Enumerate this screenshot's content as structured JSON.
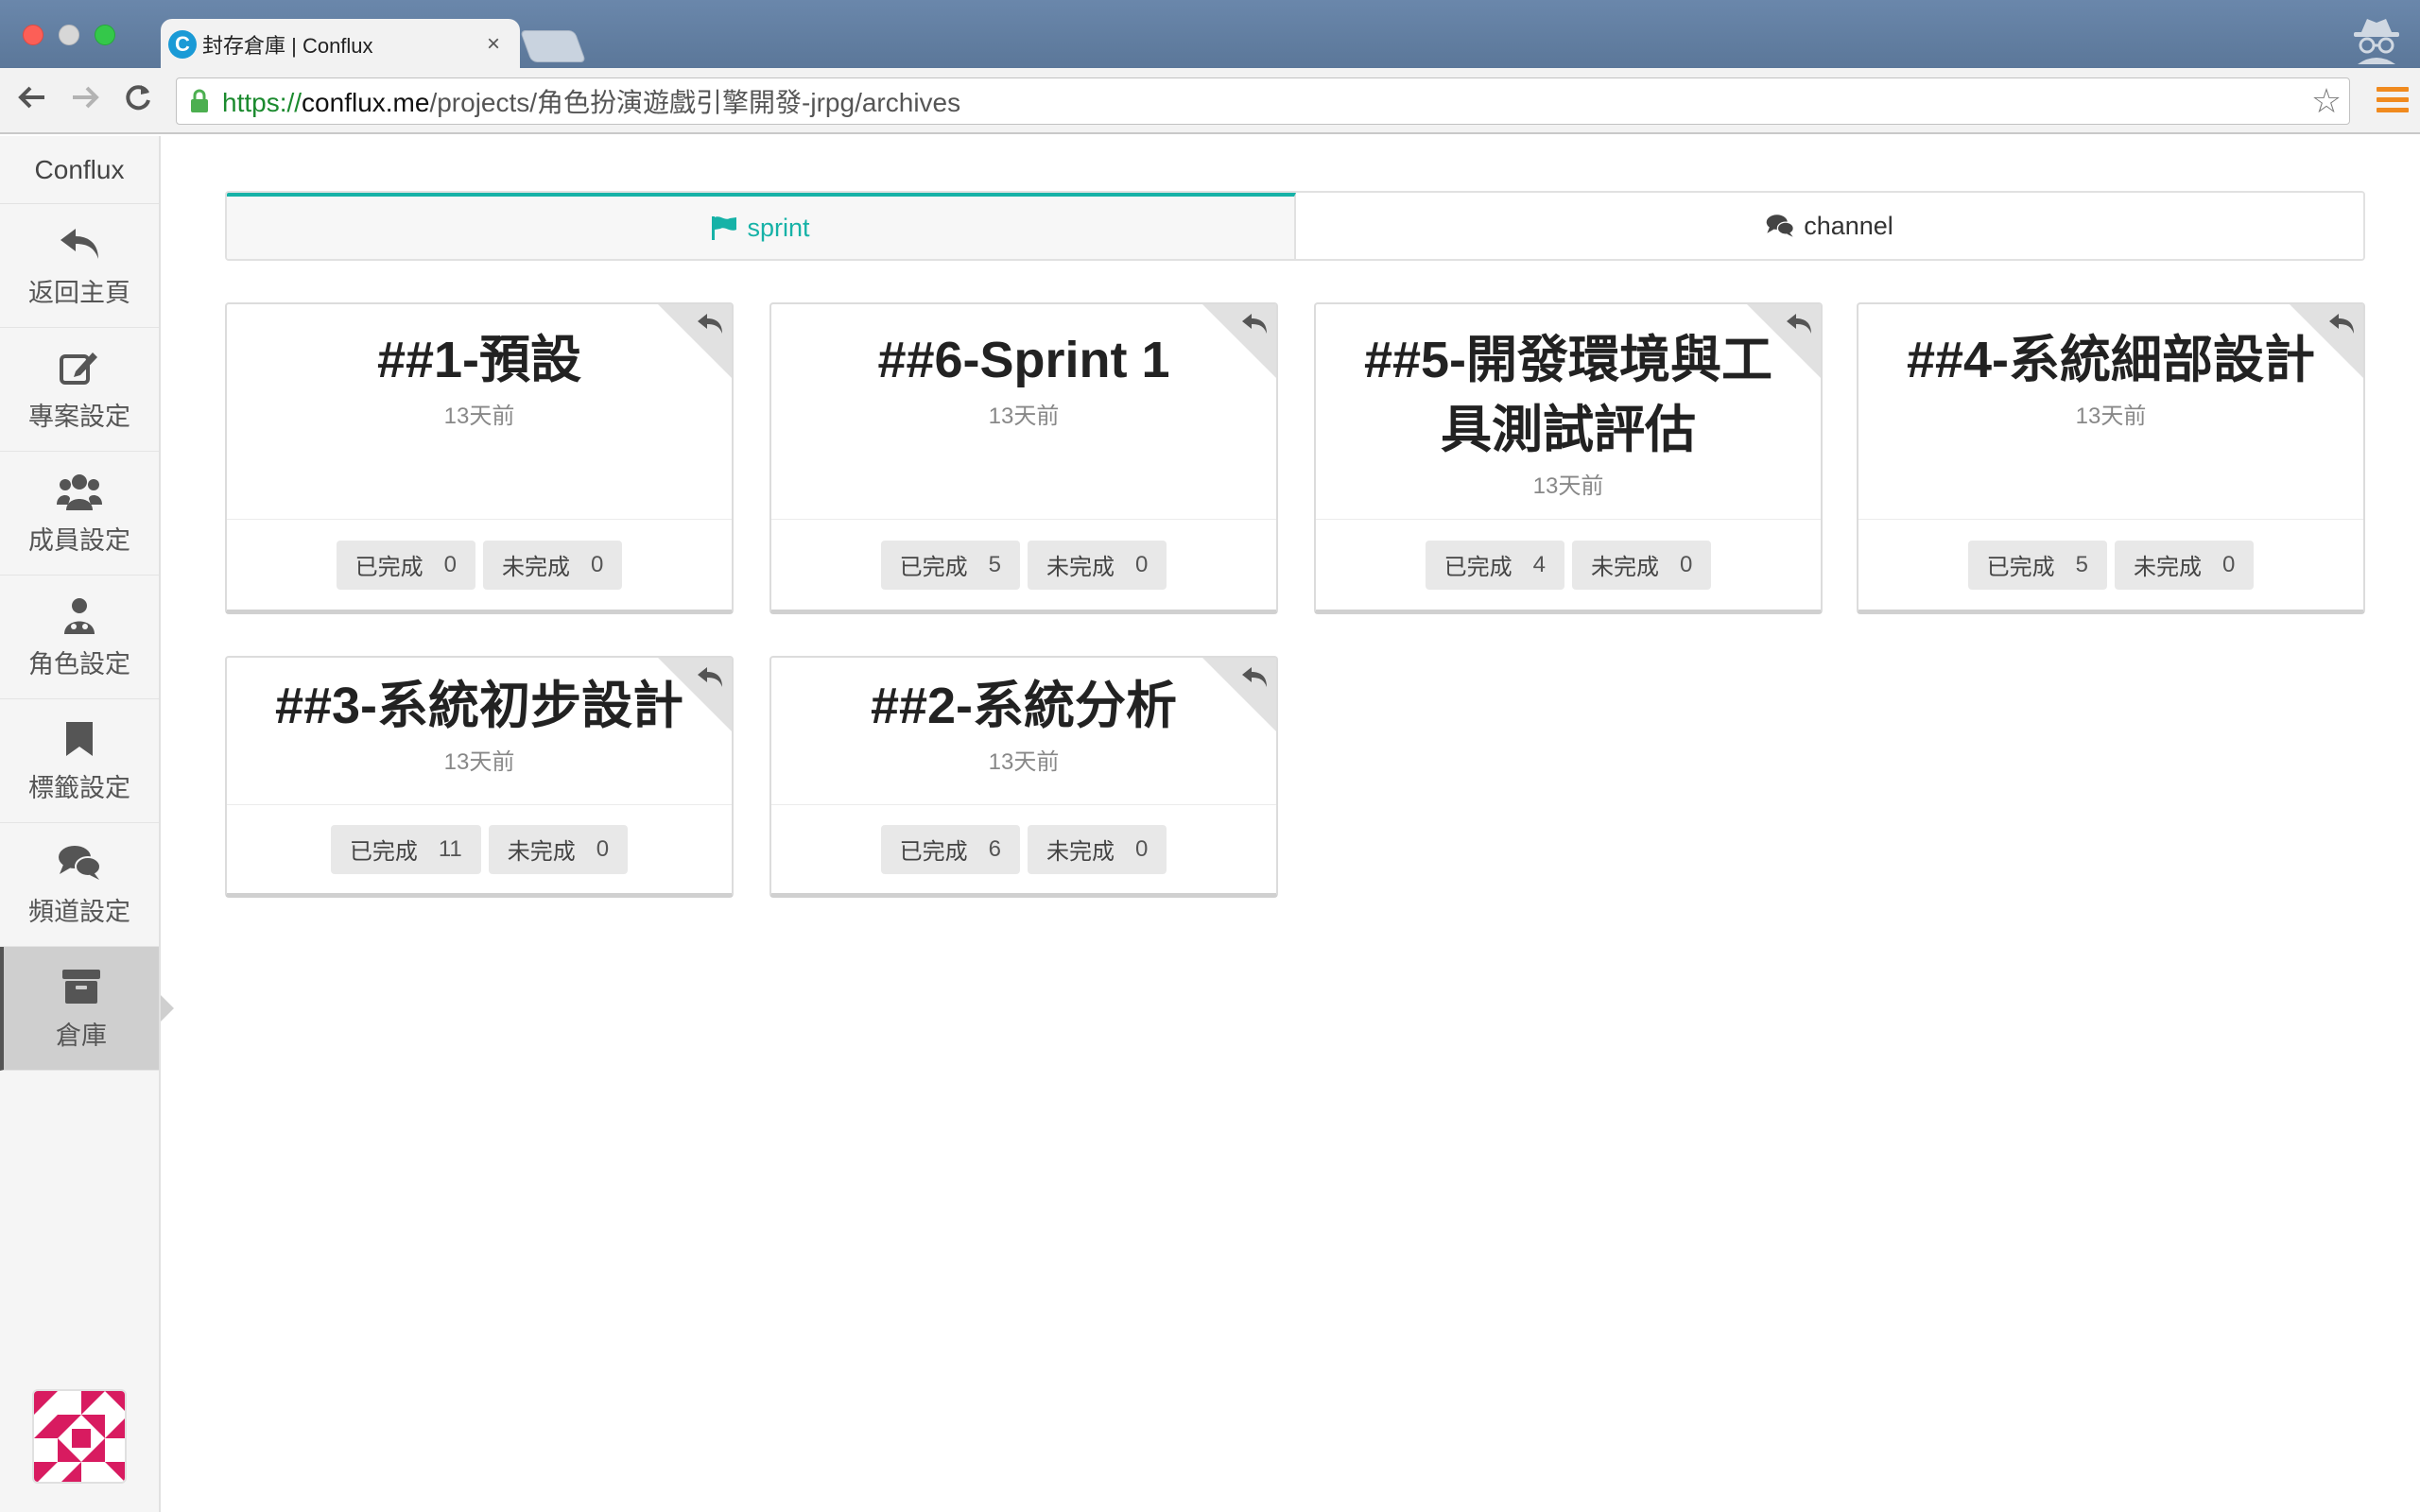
{
  "browser": {
    "tab_title": "封存倉庫 | Conflux",
    "tab_close": "×",
    "url_scheme": "https://",
    "url_host": "conflux.me",
    "url_path": "/projects/角色扮演遊戲引擎開發-jrpg/archives"
  },
  "sidebar": {
    "brand": "Conflux",
    "items": [
      {
        "label": "返回主頁",
        "icon": "reply-arrow-icon"
      },
      {
        "label": "專案設定",
        "icon": "edit-icon"
      },
      {
        "label": "成員設定",
        "icon": "users-icon"
      },
      {
        "label": "角色設定",
        "icon": "user-role-icon"
      },
      {
        "label": "標籤設定",
        "icon": "bookmark-icon"
      },
      {
        "label": "頻道設定",
        "icon": "comments-icon"
      },
      {
        "label": "倉庫",
        "icon": "archive-icon",
        "active": true
      }
    ]
  },
  "tabs": [
    {
      "label": "sprint",
      "icon": "flag-icon",
      "active": true
    },
    {
      "label": "channel",
      "icon": "comments-icon",
      "active": false
    }
  ],
  "sprints": [
    {
      "name": "##1-預設",
      "time": "13天前",
      "done_label": "已完成",
      "done": "0",
      "todo_label": "未完成",
      "todo": "0"
    },
    {
      "name": "##6-Sprint 1",
      "time": "13天前",
      "done_label": "已完成",
      "done": "5",
      "todo_label": "未完成",
      "todo": "0"
    },
    {
      "name": "##5-開發環境與工具測試評估",
      "time": "13天前",
      "done_label": "已完成",
      "done": "4",
      "todo_label": "未完成",
      "todo": "0"
    },
    {
      "name": "##4-系統細部設計",
      "time": "13天前",
      "done_label": "已完成",
      "done": "5",
      "todo_label": "未完成",
      "todo": "0"
    },
    {
      "name": "##3-系統初步設計",
      "time": "13天前",
      "done_label": "已完成",
      "done": "11",
      "todo_label": "未完成",
      "todo": "0"
    },
    {
      "name": "##2-系統分析",
      "time": "13天前",
      "done_label": "已完成",
      "done": "6",
      "todo_label": "未完成",
      "todo": "0"
    }
  ],
  "colors": {
    "accent": "#16b2a7",
    "url_green": "#1b8a2e",
    "menu_orange": "#f08a1e",
    "avatar_pink": "#d81b60"
  }
}
